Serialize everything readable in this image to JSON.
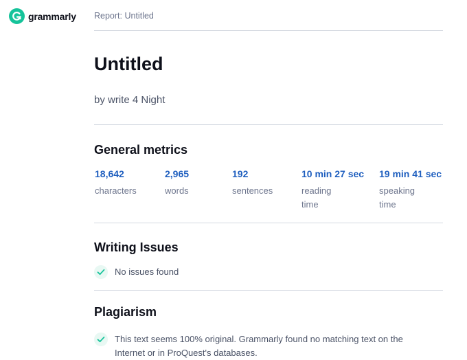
{
  "header": {
    "logo_text": "grammarly",
    "report_title": "Report: Untitled"
  },
  "document": {
    "title": "Untitled",
    "byline": "by write 4 Night"
  },
  "general_metrics": {
    "heading": "General metrics",
    "items": [
      {
        "value": "18,642",
        "label": "characters"
      },
      {
        "value": "2,965",
        "label": "words"
      },
      {
        "value": "192",
        "label": "sentences"
      },
      {
        "value": "10 min 27 sec",
        "label": "reading time"
      },
      {
        "value": "19 min 41 sec",
        "label": "speaking time"
      }
    ]
  },
  "writing_issues": {
    "heading": "Writing Issues",
    "status": "No issues found"
  },
  "plagiarism": {
    "heading": "Plagiarism",
    "status": "This text seems 100% original. Grammarly found no matching text on the Internet or in ProQuest's databases."
  },
  "colors": {
    "brand": "#15c39a",
    "metric_value": "#1f5fbf",
    "divider": "#d3d8e0"
  },
  "icons": {
    "logo": "grammarly-g-icon",
    "check": "checkmark-icon"
  }
}
